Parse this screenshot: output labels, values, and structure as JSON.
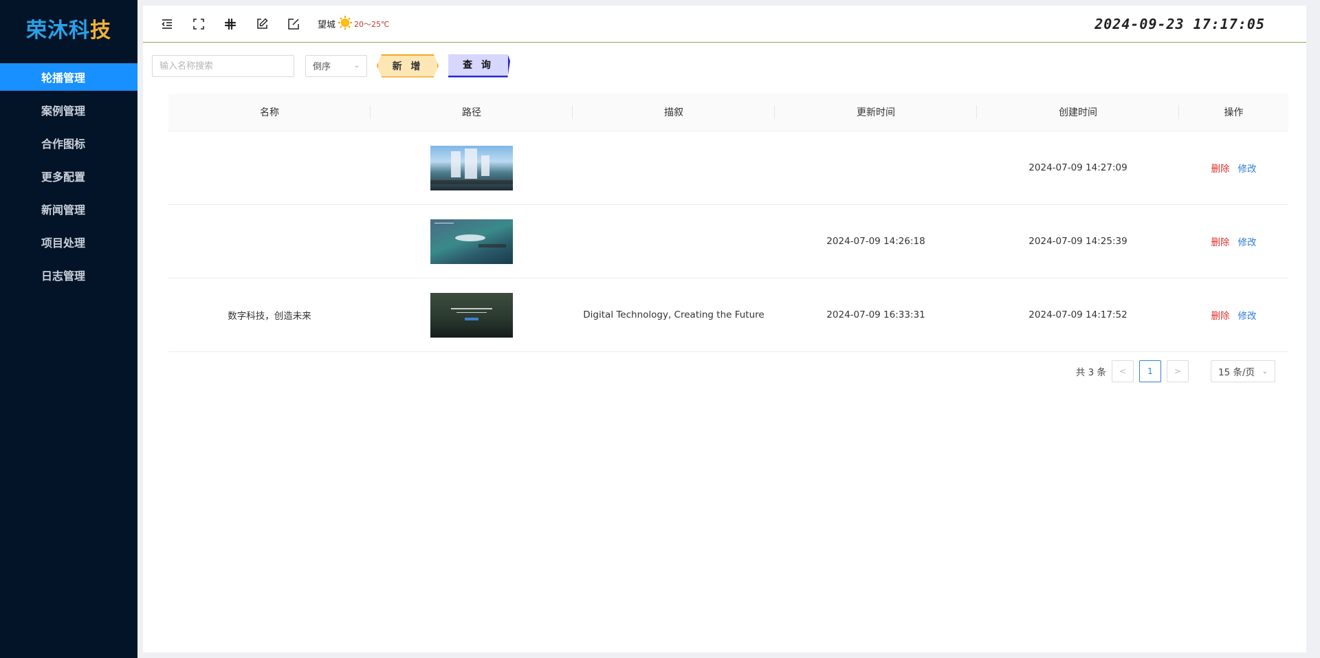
{
  "brand": {
    "logo_main": "荣沐科",
    "logo_accent": "技"
  },
  "sidebar": {
    "items": [
      {
        "label": "轮播管理"
      },
      {
        "label": "案例管理"
      },
      {
        "label": "合作图标"
      },
      {
        "label": "更多配置"
      },
      {
        "label": "新闻管理"
      },
      {
        "label": "项目处理"
      },
      {
        "label": "日志管理"
      }
    ],
    "active_index": 0
  },
  "topbar": {
    "icons": [
      "menu-fold-icon",
      "fullscreen-icon",
      "slack-icon",
      "edit-icon",
      "edit-check-icon"
    ],
    "weather": {
      "city": "望城",
      "icon": "sun-icon",
      "temp": "20～25℃"
    },
    "datetime": "2024-09-23  17:17:05"
  },
  "toolbar": {
    "search_placeholder": "输入名称搜索",
    "sort_value": "倒序",
    "add_label": "新 增",
    "query_label": "查 询"
  },
  "table": {
    "headers": [
      "名称",
      "路径",
      "描叙",
      "更新时间",
      "创建时间",
      "操作"
    ],
    "rows": [
      {
        "name": "",
        "desc": "",
        "updated": "",
        "created": "2024-07-09 14:27:09"
      },
      {
        "name": "",
        "desc": "",
        "updated": "2024-07-09 14:26:18",
        "created": "2024-07-09 14:25:39"
      },
      {
        "name": "数字科技，创造未来",
        "desc": "Digital Technology, Creating the Future",
        "updated": "2024-07-09 16:33:31",
        "created": "2024-07-09 14:17:52"
      }
    ],
    "delete_label": "删除",
    "edit_label": "修改"
  },
  "pagination": {
    "total_label": "共 3 条",
    "current_page": "1",
    "prev_icon": "<",
    "next_icon": ">",
    "page_size": "15 条/页"
  },
  "colors": {
    "sidebar_bg": "#041428",
    "active": "#1890ff",
    "delete": "#e0322d",
    "edit": "#2f7fd6"
  }
}
